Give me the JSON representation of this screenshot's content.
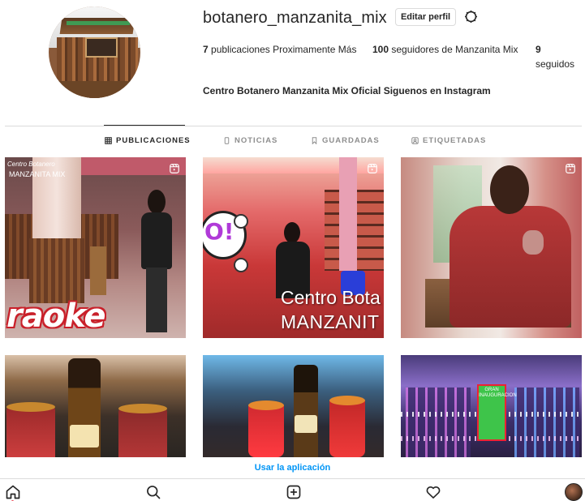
{
  "profile": {
    "username": "botanero_manzanita_mix",
    "edit_label": "Editar perfil",
    "posts_count": "7",
    "posts_text": "publicaciones Proximamente Más",
    "followers_count": "100",
    "followers_text": "seguidores de Manzanita Mix",
    "following_count": "9",
    "following_text": "seguidos",
    "bio": "Centro Botanero Manzanita Mix Oficial Siguenos en Instagram"
  },
  "tabs": [
    {
      "label": "PUBLICACIONES",
      "icon": "grid-icon",
      "active": true
    },
    {
      "label": "NOTICIAS",
      "icon": "tv-icon",
      "active": false
    },
    {
      "label": "GUARDADAS",
      "icon": "bookmark-icon",
      "active": false
    },
    {
      "label": "ETIQUETADAS",
      "icon": "tag-icon",
      "active": false
    }
  ],
  "posts": {
    "p1": {
      "overlay": "raoke",
      "logo_line1": "Centro Botanero",
      "logo_line2": "MANZANITA MIX",
      "icon": "reel-icon"
    },
    "p2": {
      "overlay_line1": "Centro Bota",
      "overlay_line2": "MANZANIT",
      "bubble": "O!",
      "icon": "reel-icon"
    },
    "p3": {
      "icon": "reel-icon"
    },
    "p6": {
      "sign": "GRAN INAUGURACION"
    }
  },
  "banner": {
    "use_app": "Usar la aplicación"
  },
  "bottom_nav": [
    "home-icon",
    "search-icon",
    "new-post-icon",
    "heart-icon",
    "profile-avatar"
  ],
  "colors": {
    "link_blue": "#0095f6",
    "text": "#262626",
    "muted": "#8e8e8e",
    "notification_red": "#ed4956"
  }
}
